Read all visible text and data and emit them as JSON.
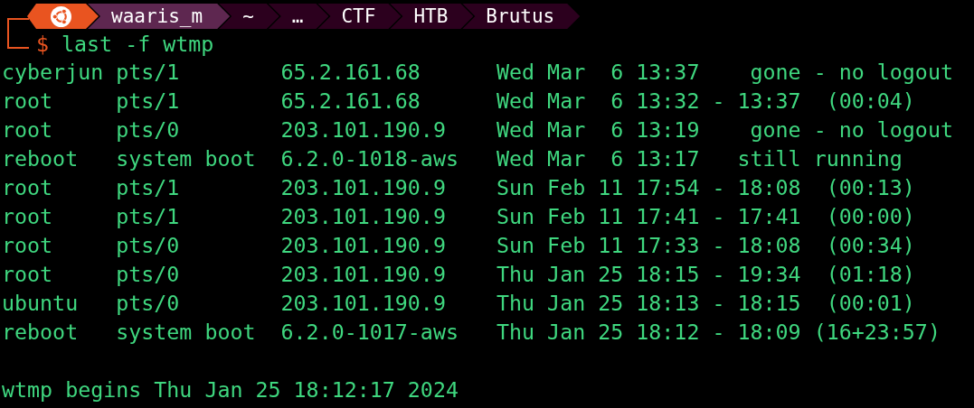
{
  "prompt": {
    "segments": [
      {
        "kind": "logo"
      },
      {
        "kind": "user",
        "text": "waaris_m"
      },
      {
        "kind": "path",
        "text": "~"
      },
      {
        "kind": "path",
        "text": "…"
      },
      {
        "kind": "path",
        "text": "CTF"
      },
      {
        "kind": "path",
        "text": "HTB"
      },
      {
        "kind": "path",
        "text": "Brutus"
      }
    ],
    "symbol": "$",
    "command": "last -f wtmp"
  },
  "output": [
    "cyberjun pts/1        65.2.161.68      Wed Mar  6 13:37    gone - no logout",
    "root     pts/1        65.2.161.68      Wed Mar  6 13:32 - 13:37  (00:04)",
    "root     pts/0        203.101.190.9    Wed Mar  6 13:19    gone - no logout",
    "reboot   system boot  6.2.0-1018-aws   Wed Mar  6 13:17   still running",
    "root     pts/1        203.101.190.9    Sun Feb 11 17:54 - 18:08  (00:13)",
    "root     pts/1        203.101.190.9    Sun Feb 11 17:41 - 17:41  (00:00)",
    "root     pts/0        203.101.190.9    Sun Feb 11 17:33 - 18:08  (00:34)",
    "root     pts/0        203.101.190.9    Thu Jan 25 18:15 - 19:34  (01:18)",
    "ubuntu   pts/0        203.101.190.9    Thu Jan 25 18:13 - 18:15  (00:01)",
    "reboot   system boot  6.2.0-1017-aws   Thu Jan 25 18:12 - 18:09 (16+23:57)"
  ],
  "footer": "wtmp begins Thu Jan 25 18:12:17 2024"
}
